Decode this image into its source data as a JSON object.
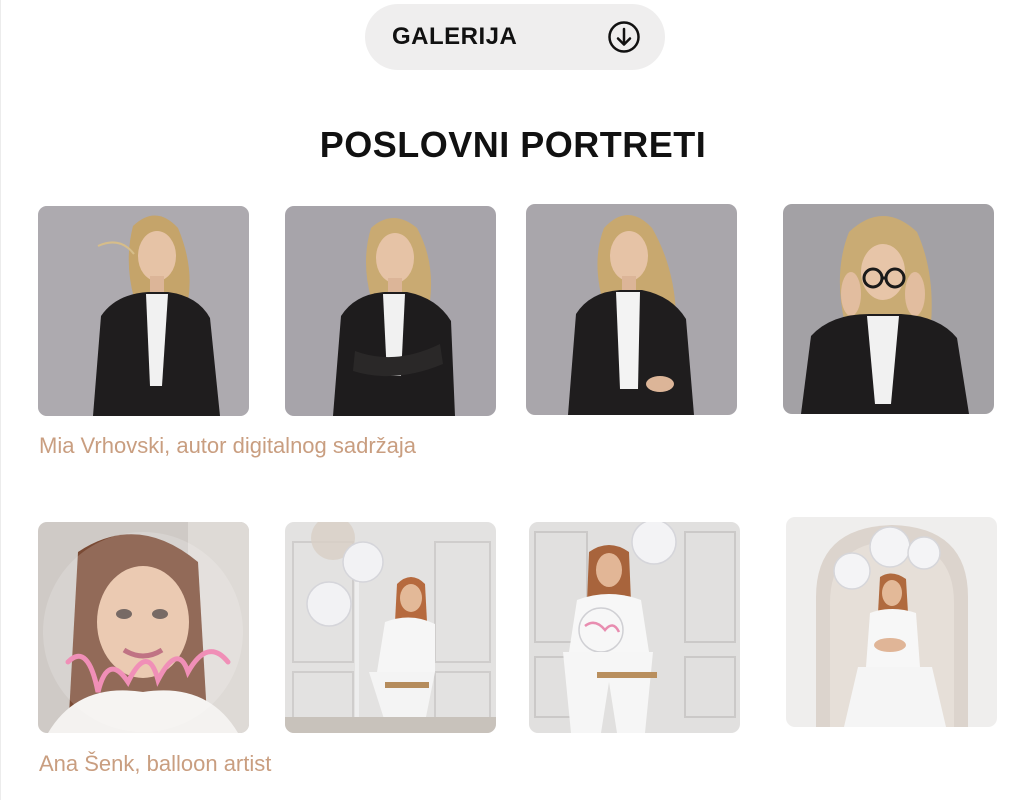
{
  "gallery_button": {
    "label": "GALERIJA",
    "icon": "arrow-down-circle-icon"
  },
  "section": {
    "title": "POSLOVNI PORTRETI"
  },
  "groups": [
    {
      "caption": "Mia Vrhovski, autor digitalnog sadržaja"
    },
    {
      "caption": "Ana Šenk, balloon artist"
    }
  ],
  "colors": {
    "caption": "#c99e80",
    "button_bg": "#efeeee",
    "text": "#111111"
  }
}
